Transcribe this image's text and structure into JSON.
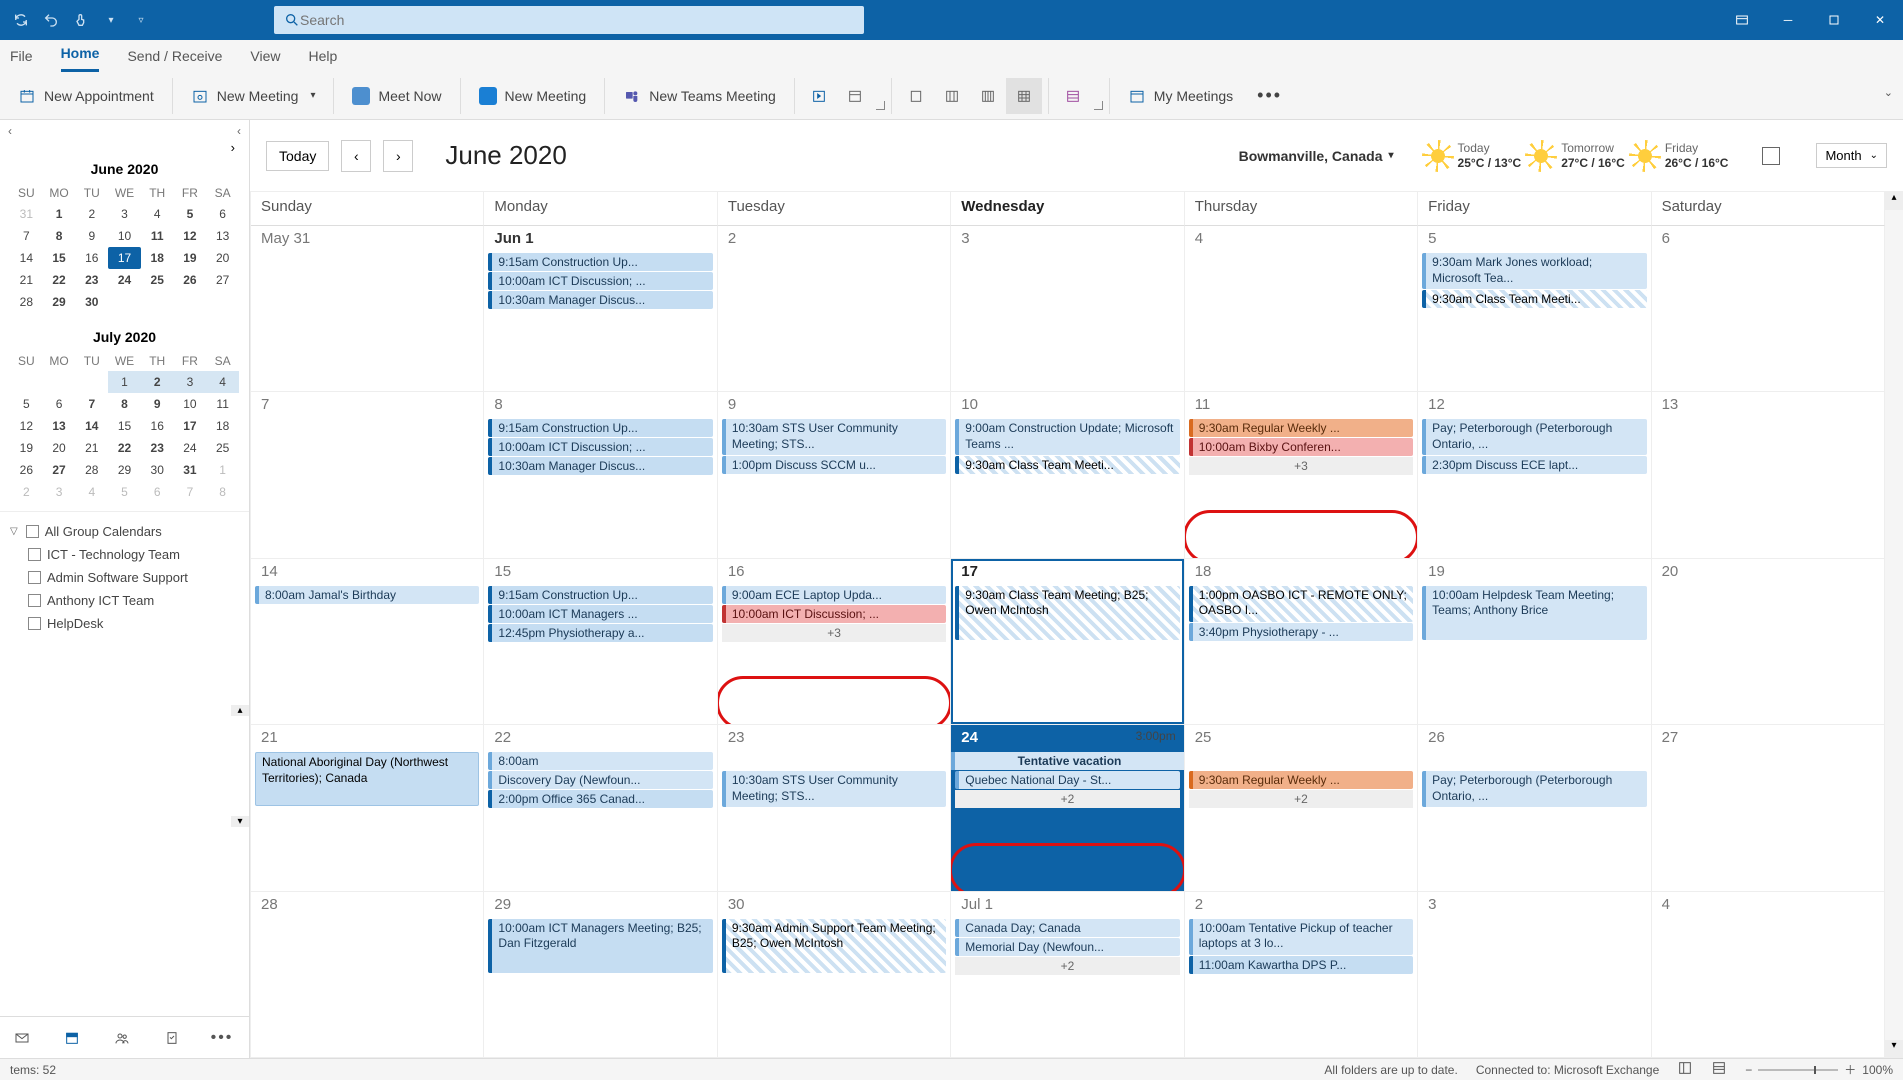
{
  "titlebar": {
    "search_placeholder": "Search"
  },
  "menu": {
    "file": "File",
    "home": "Home",
    "sendreceive": "Send / Receive",
    "view": "View",
    "help": "Help"
  },
  "ribbon": {
    "new_appointment": "New Appointment",
    "new_meeting": "New Meeting",
    "meet_now": "Meet Now",
    "new_meeting2": "New Meeting",
    "new_teams": "New Teams Meeting",
    "my_meetings": "My Meetings"
  },
  "minical1": {
    "title": "June 2020",
    "dows": [
      "SU",
      "MO",
      "TU",
      "WE",
      "TH",
      "FR",
      "SA"
    ],
    "rows": [
      [
        {
          "n": "31",
          "off": true
        },
        {
          "n": "1",
          "bold": true
        },
        {
          "n": "2"
        },
        {
          "n": "3"
        },
        {
          "n": "4"
        },
        {
          "n": "5",
          "bold": true
        },
        {
          "n": "6"
        }
      ],
      [
        {
          "n": "7"
        },
        {
          "n": "8",
          "bold": true
        },
        {
          "n": "9"
        },
        {
          "n": "10"
        },
        {
          "n": "11",
          "bold": true
        },
        {
          "n": "12",
          "bold": true
        },
        {
          "n": "13"
        }
      ],
      [
        {
          "n": "14"
        },
        {
          "n": "15",
          "bold": true
        },
        {
          "n": "16"
        },
        {
          "n": "17",
          "today": true
        },
        {
          "n": "18",
          "bold": true
        },
        {
          "n": "19",
          "bold": true
        },
        {
          "n": "20"
        }
      ],
      [
        {
          "n": "21"
        },
        {
          "n": "22",
          "bold": true
        },
        {
          "n": "23",
          "bold": true
        },
        {
          "n": "24",
          "bold": true
        },
        {
          "n": "25",
          "bold": true
        },
        {
          "n": "26",
          "bold": true
        },
        {
          "n": "27"
        }
      ],
      [
        {
          "n": "28"
        },
        {
          "n": "29",
          "bold": true
        },
        {
          "n": "30",
          "bold": true
        },
        {
          "n": "",
          "off": true
        },
        {
          "n": "",
          "off": true
        },
        {
          "n": "",
          "off": true
        },
        {
          "n": "",
          "off": true
        }
      ]
    ]
  },
  "minical2": {
    "title": "July 2020",
    "dows": [
      "SU",
      "MO",
      "TU",
      "WE",
      "TH",
      "FR",
      "SA"
    ],
    "rows": [
      [
        {
          "n": "",
          "off": true
        },
        {
          "n": "",
          "off": true
        },
        {
          "n": "",
          "off": true
        },
        {
          "n": "1",
          "shade": true
        },
        {
          "n": "2",
          "bold": true,
          "shade": true
        },
        {
          "n": "3",
          "shade": true
        },
        {
          "n": "4",
          "shade": true
        }
      ],
      [
        {
          "n": "5"
        },
        {
          "n": "6"
        },
        {
          "n": "7",
          "bold": true
        },
        {
          "n": "8",
          "bold": true
        },
        {
          "n": "9",
          "bold": true
        },
        {
          "n": "10"
        },
        {
          "n": "11"
        }
      ],
      [
        {
          "n": "12"
        },
        {
          "n": "13",
          "bold": true
        },
        {
          "n": "14",
          "bold": true
        },
        {
          "n": "15"
        },
        {
          "n": "16"
        },
        {
          "n": "17",
          "bold": true
        },
        {
          "n": "18"
        }
      ],
      [
        {
          "n": "19"
        },
        {
          "n": "20"
        },
        {
          "n": "21"
        },
        {
          "n": "22",
          "bold": true
        },
        {
          "n": "23",
          "bold": true
        },
        {
          "n": "24"
        },
        {
          "n": "25"
        }
      ],
      [
        {
          "n": "26"
        },
        {
          "n": "27",
          "bold": true
        },
        {
          "n": "28"
        },
        {
          "n": "29"
        },
        {
          "n": "30"
        },
        {
          "n": "31",
          "bold": true
        },
        {
          "n": "1",
          "off": true
        }
      ],
      [
        {
          "n": "2",
          "off": true
        },
        {
          "n": "3",
          "off": true
        },
        {
          "n": "4",
          "off": true
        },
        {
          "n": "5",
          "off": true
        },
        {
          "n": "6",
          "off": true
        },
        {
          "n": "7",
          "off": true
        },
        {
          "n": "8",
          "off": true
        }
      ]
    ]
  },
  "calendars": {
    "all": "All Group Calendars",
    "c1": "ICT - Technology Team",
    "c2": "Admin Software Support",
    "c3": "Anthony ICT Team",
    "c4": "HelpDesk"
  },
  "chead": {
    "today": "Today",
    "title": "June 2020",
    "location": "Bowmanville, Canada",
    "w1_label": "Today",
    "w1_temp": "25°C / 13°C",
    "w2_label": "Tomorrow",
    "w2_temp": "27°C / 16°C",
    "w3_label": "Friday",
    "w3_temp": "26°C / 16°C",
    "month": "Month"
  },
  "dows": [
    "Sunday",
    "Monday",
    "Tuesday",
    "Wednesday",
    "Thursday",
    "Friday",
    "Saturday"
  ],
  "grid": [
    [
      {
        "n": "May 31"
      },
      {
        "n": "Jun 1",
        "bold": true,
        "ev": [
          {
            "t": "9:15am Construction Up...",
            "c": "blue"
          },
          {
            "t": "10:00am ICT Discussion; ...",
            "c": "blue"
          },
          {
            "t": "10:30am Manager Discus...",
            "c": "blue"
          }
        ]
      },
      {
        "n": "2"
      },
      {
        "n": "3"
      },
      {
        "n": "4"
      },
      {
        "n": "5",
        "ev": [
          {
            "t": "9:30am Mark Jones workload; Microsoft Tea...",
            "c": "lblue",
            "h": 2
          },
          {
            "t": "9:30am Class Team Meeti...",
            "c": "tent"
          }
        ]
      },
      {
        "n": "6"
      }
    ],
    [
      {
        "n": "7"
      },
      {
        "n": "8",
        "ev": [
          {
            "t": "9:15am Construction Up...",
            "c": "blue"
          },
          {
            "t": "10:00am ICT Discussion; ...",
            "c": "blue"
          },
          {
            "t": "10:30am Manager Discus...",
            "c": "blue"
          }
        ]
      },
      {
        "n": "9",
        "ev": [
          {
            "t": "10:30am STS User Community Meeting; STS...",
            "c": "lblue",
            "h": 2
          },
          {
            "t": "1:00pm Discuss SCCM u...",
            "c": "lblue"
          }
        ]
      },
      {
        "n": "10",
        "ev": [
          {
            "t": "9:00am Construction Update; Microsoft Teams ...",
            "c": "lblue",
            "h": 2
          },
          {
            "t": "9:30am Class Team Meeti...",
            "c": "tent"
          }
        ]
      },
      {
        "n": "11",
        "ev": [
          {
            "t": "9:30am Regular Weekly ...",
            "c": "orange"
          },
          {
            "t": "10:00am Bixby Conferen...",
            "c": "red"
          }
        ],
        "more": "+3",
        "mark": true
      },
      {
        "n": "12",
        "ev": [
          {
            "t": "Pay; Peterborough (Peterborough  Ontario, ...",
            "c": "lblue",
            "h": 2
          },
          {
            "t": "2:30pm Discuss ECE lapt...",
            "c": "lblue"
          }
        ]
      },
      {
        "n": "13"
      }
    ],
    [
      {
        "n": "14",
        "ev": [
          {
            "t": "8:00am Jamal's Birthday",
            "c": "lblue"
          }
        ]
      },
      {
        "n": "15",
        "ev": [
          {
            "t": "9:15am Construction Up...",
            "c": "blue"
          },
          {
            "t": "10:00am ICT Managers ...",
            "c": "blue"
          },
          {
            "t": "12:45pm Physiotherapy a...",
            "c": "blue"
          }
        ]
      },
      {
        "n": "16",
        "ev": [
          {
            "t": "9:00am ECE Laptop Upda...",
            "c": "lblue"
          },
          {
            "t": "10:00am ICT Discussion; ...",
            "c": "red"
          }
        ],
        "more": "+3",
        "mark": true
      },
      {
        "n": "17",
        "today": true,
        "ev": [
          {
            "t": "9:30am Class Team Meeting; B25; Owen McIntosh",
            "c": "tent",
            "h": 3
          }
        ]
      },
      {
        "n": "18",
        "ev": [
          {
            "t": "1:00pm OASBO ICT - REMOTE ONLY; OASBO I...",
            "c": "tent",
            "h": 2
          },
          {
            "t": "3:40pm Physiotherapy - ...",
            "c": "lblue"
          }
        ]
      },
      {
        "n": "19",
        "ev": [
          {
            "t": "10:00am Helpdesk Team Meeting; Teams; Anthony Brice",
            "c": "lblue",
            "h": 3
          }
        ]
      },
      {
        "n": "20"
      }
    ],
    [
      {
        "n": "21",
        "ev": [
          {
            "t": "National Aboriginal Day (Northwest Territories); Canada",
            "c": "allday",
            "h": 3
          }
        ]
      },
      {
        "n": "22",
        "ev": [
          {
            "t": "8:00am",
            "c": "lblue"
          },
          {
            "t": "Discovery Day (Newfoun...",
            "c": "lblue"
          },
          {
            "t": "2:00pm Office 365 Canad...",
            "c": "blue"
          }
        ]
      },
      {
        "n": "23",
        "ev": [
          {
            "t": "",
            "c": "none"
          },
          {
            "t": "10:30am STS User Community Meeting; STS...",
            "c": "lblue",
            "h": 2
          }
        ]
      },
      {
        "n": "24",
        "todayHdr": true,
        "rt": "3:00pm",
        "span": "Tentative vacation",
        "ev": [
          {
            "t": "Quebec National Day - St...",
            "c": "lblue"
          }
        ],
        "more": "+2",
        "mark": true
      },
      {
        "n": "25",
        "ev": [
          {
            "t": "",
            "c": "none"
          },
          {
            "t": "9:30am Regular Weekly ...",
            "c": "orange"
          }
        ],
        "more": "+2"
      },
      {
        "n": "26",
        "ev": [
          {
            "t": "",
            "c": "none"
          },
          {
            "t": "Pay; Peterborough (Peterborough  Ontario, ...",
            "c": "lblue",
            "h": 2
          }
        ]
      },
      {
        "n": "27"
      }
    ],
    [
      {
        "n": "28"
      },
      {
        "n": "29",
        "ev": [
          {
            "t": "10:00am ICT Managers Meeting; B25; Dan Fitzgerald",
            "c": "blue",
            "h": 3
          }
        ]
      },
      {
        "n": "30",
        "ev": [
          {
            "t": "9:30am Admin Support Team Meeting; B25; Owen McIntosh",
            "c": "tent",
            "h": 3
          }
        ]
      },
      {
        "n": "Jul 1",
        "ev": [
          {
            "t": "Canada Day; Canada",
            "c": "lblue"
          },
          {
            "t": "Memorial Day (Newfoun...",
            "c": "lblue"
          }
        ],
        "more": "+2"
      },
      {
        "n": "2",
        "ev": [
          {
            "t": "10:00am Tentative Pickup of teacher laptops at 3 lo...",
            "c": "lblue",
            "h": 2
          },
          {
            "t": "11:00am Kawartha DPS P...",
            "c": "blue"
          }
        ]
      },
      {
        "n": "3"
      },
      {
        "n": "4"
      }
    ]
  ],
  "status": {
    "items": "tems: 52",
    "folders": "All folders are up to date.",
    "conn": "Connected to: Microsoft Exchange",
    "zoom": "100%"
  }
}
